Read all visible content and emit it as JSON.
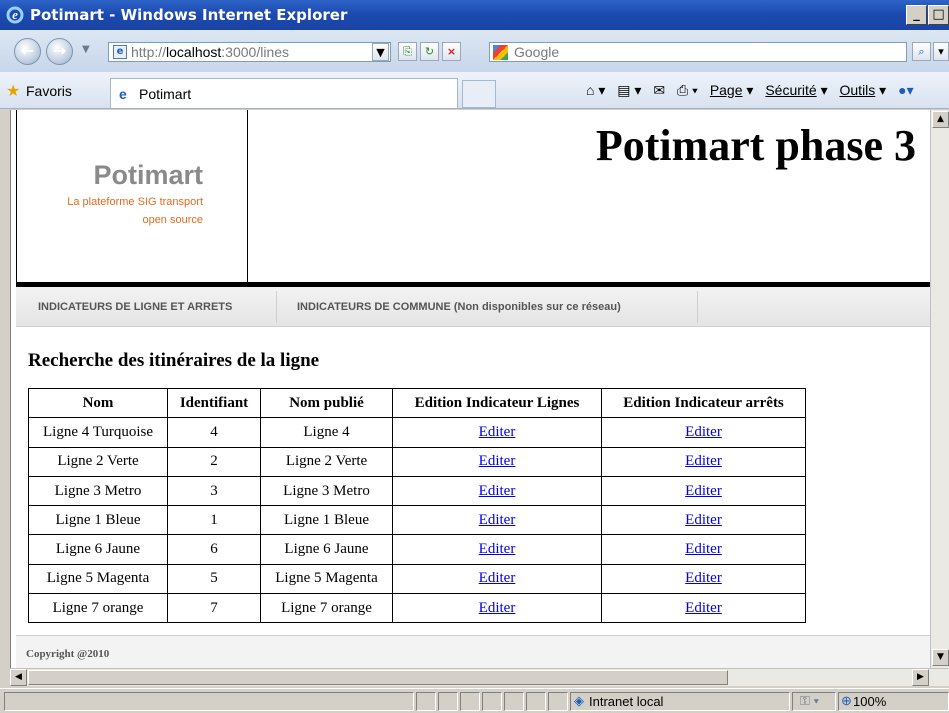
{
  "window": {
    "title": "Potimart - Windows Internet Explorer",
    "minimize_glyph": "_",
    "maximize_glyph": "□",
    "close_glyph": "×"
  },
  "addressbar": {
    "url_scheme": "http://",
    "url_host": "localhost",
    "url_rest": ":3000/lines",
    "search_placeholder": "Google"
  },
  "favbar": {
    "favorites_label": "Favoris",
    "tab_label": "Potimart",
    "commands": [
      "Page",
      "Sécurité",
      "Outils"
    ]
  },
  "header": {
    "logo_name": "Potimart",
    "logo_tagline_1": "La plateforme SIG transport",
    "logo_tagline_2": "open source",
    "page_title": "Potimart phase 3"
  },
  "menu": {
    "items": [
      "INDICATEURS DE LIGNE ET ARRETS",
      "INDICATEURS DE COMMUNE (Non disponibles sur ce réseau)"
    ]
  },
  "main": {
    "section_title": "Recherche des itinéraires de la ligne",
    "table": {
      "headers": [
        "Nom",
        "Identifiant",
        "Nom publié",
        "Edition Indicateur Lignes",
        "Edition Indicateur arrêts"
      ],
      "rows": [
        {
          "nom": "Ligne 4 Turquoise",
          "id": "4",
          "publie": "Ligne 4",
          "edit_lignes": "Editer",
          "edit_arrets": "Editer"
        },
        {
          "nom": "Ligne 2 Verte",
          "id": "2",
          "publie": "Ligne 2 Verte",
          "edit_lignes": "Editer",
          "edit_arrets": "Editer"
        },
        {
          "nom": "Ligne 3 Metro",
          "id": "3",
          "publie": "Ligne 3 Metro",
          "edit_lignes": "Editer",
          "edit_arrets": "Editer"
        },
        {
          "nom": "Ligne 1 Bleue",
          "id": "1",
          "publie": "Ligne 1 Bleue",
          "edit_lignes": "Editer",
          "edit_arrets": "Editer"
        },
        {
          "nom": "Ligne 6 Jaune",
          "id": "6",
          "publie": "Ligne 6 Jaune",
          "edit_lignes": "Editer",
          "edit_arrets": "Editer"
        },
        {
          "nom": "Ligne 5 Magenta",
          "id": "5",
          "publie": "Ligne 5 Magenta",
          "edit_lignes": "Editer",
          "edit_arrets": "Editer"
        },
        {
          "nom": "Ligne 7 orange",
          "id": "7",
          "publie": "Ligne 7 orange",
          "edit_lignes": "Editer",
          "edit_arrets": "Editer"
        }
      ]
    }
  },
  "footer": {
    "copyright": "Copyright @2010"
  },
  "statusbar": {
    "zone": "Intranet local",
    "zoom": "100%"
  },
  "colors": {
    "titlebar": "#1d4ab0",
    "logo_gray": "#8a8a8a",
    "logo_orange": "#e56a1f",
    "link": "#0000ee"
  }
}
